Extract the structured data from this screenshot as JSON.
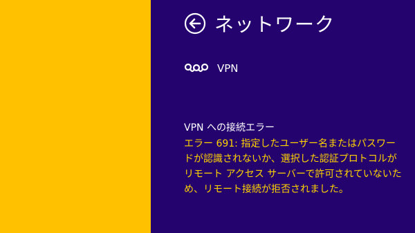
{
  "colors": {
    "desktop_background": "#FFC100",
    "charm_background": "#24036E",
    "text_primary": "#FFFFFF",
    "error_text": "#FFD200"
  },
  "header": {
    "back_icon": "arrow-left-circle-icon",
    "title": "ネットワーク"
  },
  "connection": {
    "icon": "vpn-link-icon",
    "label": "VPN"
  },
  "error": {
    "title": "VPN への接続エラー",
    "message": "エラー 691: 指定したユーザー名またはパスワードが認識されないか、選択した認証プロトコルがリモート アクセス サーバーで許可されていないため、リモート接続が拒否されました。"
  }
}
